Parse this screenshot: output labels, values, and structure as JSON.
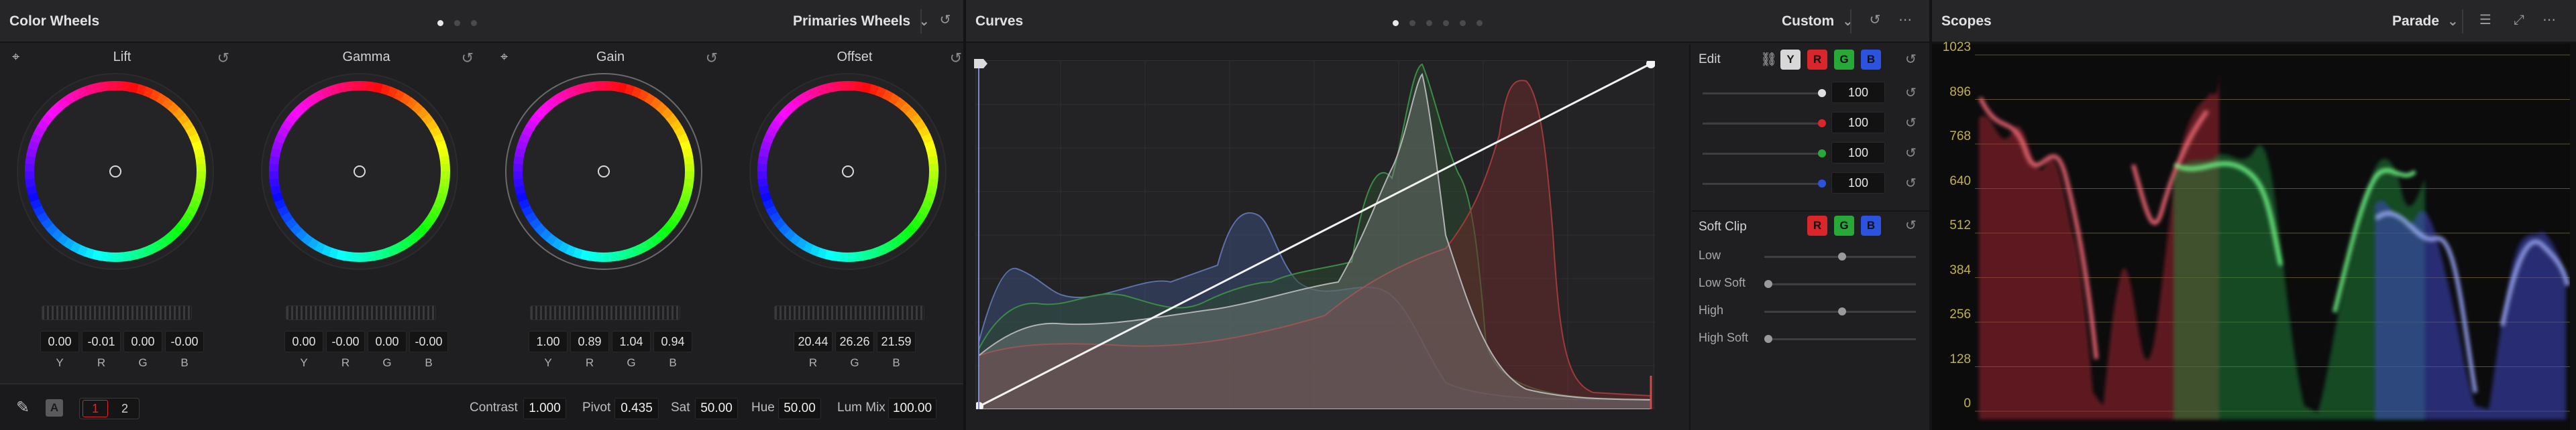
{
  "color_wheels": {
    "title": "Color Wheels",
    "mode_dropdown": "Primaries Wheels",
    "wheels": [
      {
        "label": "Lift",
        "values": [
          "0.00",
          "-0.01",
          "0.00",
          "-0.00"
        ]
      },
      {
        "label": "Gamma",
        "values": [
          "0.00",
          "-0.00",
          "0.00",
          "-0.00"
        ]
      },
      {
        "label": "Gain",
        "values": [
          "1.00",
          "0.89",
          "1.04",
          "0.94"
        ]
      },
      {
        "label": "Offset",
        "values": [
          "20.44",
          "26.26",
          "21.59"
        ]
      }
    ],
    "channel_letters": [
      "Y",
      "R",
      "G",
      "B"
    ],
    "offset_letters": [
      "R",
      "G",
      "B"
    ],
    "bottom": {
      "auto_badge": "A",
      "page_1": "1",
      "page_2": "2",
      "contrast_label": "Contrast",
      "contrast_value": "1.000",
      "pivot_label": "Pivot",
      "pivot_value": "0.435",
      "sat_label": "Sat",
      "sat_value": "50.00",
      "hue_label": "Hue",
      "hue_value": "50.00",
      "lummix_label": "Lum Mix",
      "lummix_value": "100.00"
    }
  },
  "curves": {
    "title": "Curves",
    "mode_dropdown": "Custom",
    "edit_label": "Edit",
    "channels": [
      "Y",
      "R",
      "G",
      "B"
    ],
    "intensities": [
      "100",
      "100",
      "100",
      "100"
    ],
    "soft_clip_label": "Soft Clip",
    "soft_clip_rows": [
      "Low",
      "Low Soft",
      "High",
      "High Soft"
    ]
  },
  "scopes": {
    "title": "Scopes",
    "mode_dropdown": "Parade",
    "y_ticks": [
      "1023",
      "896",
      "768",
      "640",
      "512",
      "384",
      "256",
      "128",
      "0"
    ]
  },
  "colors": {
    "red": "#d9262a",
    "green": "#27a838",
    "blue": "#2c52e0",
    "grid_yellow": "#c2b04a"
  },
  "icons": [
    "reset-icon",
    "eyedropper-icon",
    "chevron-down-icon",
    "more-icon",
    "link-icon",
    "settings-icon",
    "expand-icon"
  ]
}
